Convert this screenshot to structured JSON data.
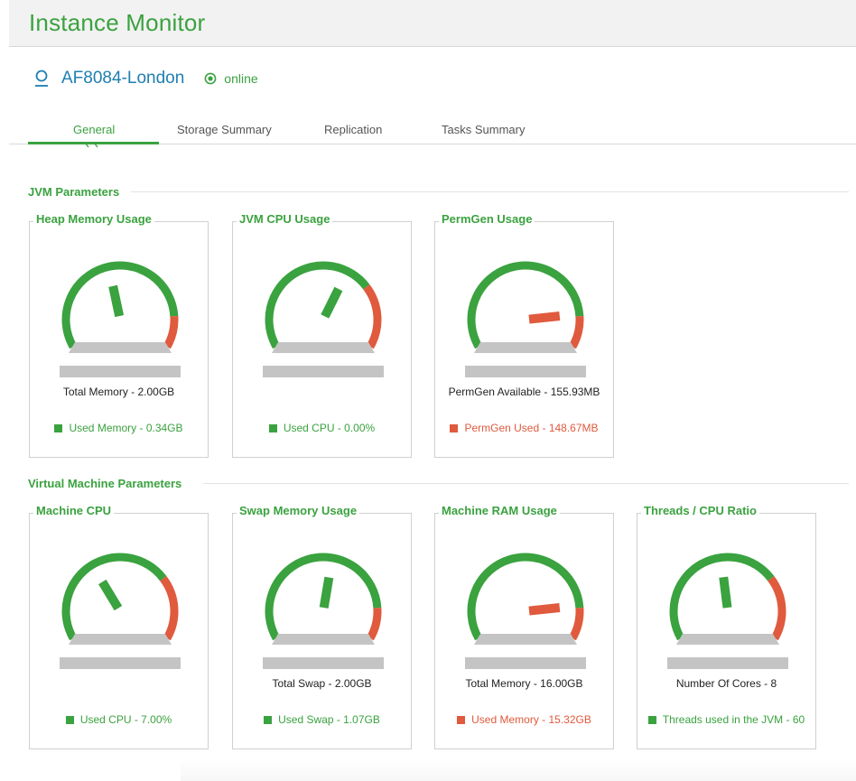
{
  "app": {
    "title": "Instance Monitor"
  },
  "instance": {
    "name": "AF8084-London",
    "status": "online"
  },
  "tabs": [
    {
      "label": "General",
      "active": true
    },
    {
      "label": "Storage Summary",
      "active": false
    },
    {
      "label": "Replication",
      "active": false
    },
    {
      "label": "Tasks Summary",
      "active": false
    }
  ],
  "colors": {
    "accent": "#3aa23f",
    "warning": "#e05a3d",
    "link": "#1f7fb0",
    "gauge_base": "#c4c4c4"
  },
  "sections": {
    "jvm": {
      "title": "JVM Parameters",
      "cards": [
        {
          "title": "Heap Memory Usage",
          "total": "Total Memory - 2.00GB",
          "legend": "Used Memory - 0.34GB",
          "legend_color": "green",
          "needle_value": 0.45,
          "warn_start": 0.86
        },
        {
          "title": "JVM CPU Usage",
          "total": "",
          "legend": "Used CPU - 0.00%",
          "legend_color": "green",
          "needle_value": 0.61,
          "warn_start": 0.72
        },
        {
          "title": "PermGen Usage",
          "total": "PermGen Available - 155.93MB",
          "legend": "PermGen Used - 148.67MB",
          "legend_color": "red",
          "needle_value": 0.85,
          "warn_start": 0.86
        }
      ]
    },
    "vm": {
      "title": "Virtual Machine Parameters",
      "cards": [
        {
          "title": "Machine CPU",
          "total": "",
          "legend": "Used CPU - 7.00%",
          "legend_color": "green",
          "needle_value": 0.37,
          "warn_start": 0.72
        },
        {
          "title": "Swap Memory Usage",
          "total": "Total Swap - 2.00GB",
          "legend": "Used Swap - 1.07GB",
          "legend_color": "green",
          "needle_value": 0.54,
          "warn_start": 0.86
        },
        {
          "title": "Machine RAM Usage",
          "total": "Total Memory - 16.00GB",
          "legend": "Used Memory - 15.32GB",
          "legend_color": "red",
          "needle_value": 0.85,
          "warn_start": 0.86
        },
        {
          "title": "Threads / CPU Ratio",
          "total": "Number Of Cores - 8",
          "legend": "Threads used in the JVM - 60",
          "legend_color": "green",
          "needle_value": 0.47,
          "warn_start": 0.72
        }
      ]
    }
  }
}
